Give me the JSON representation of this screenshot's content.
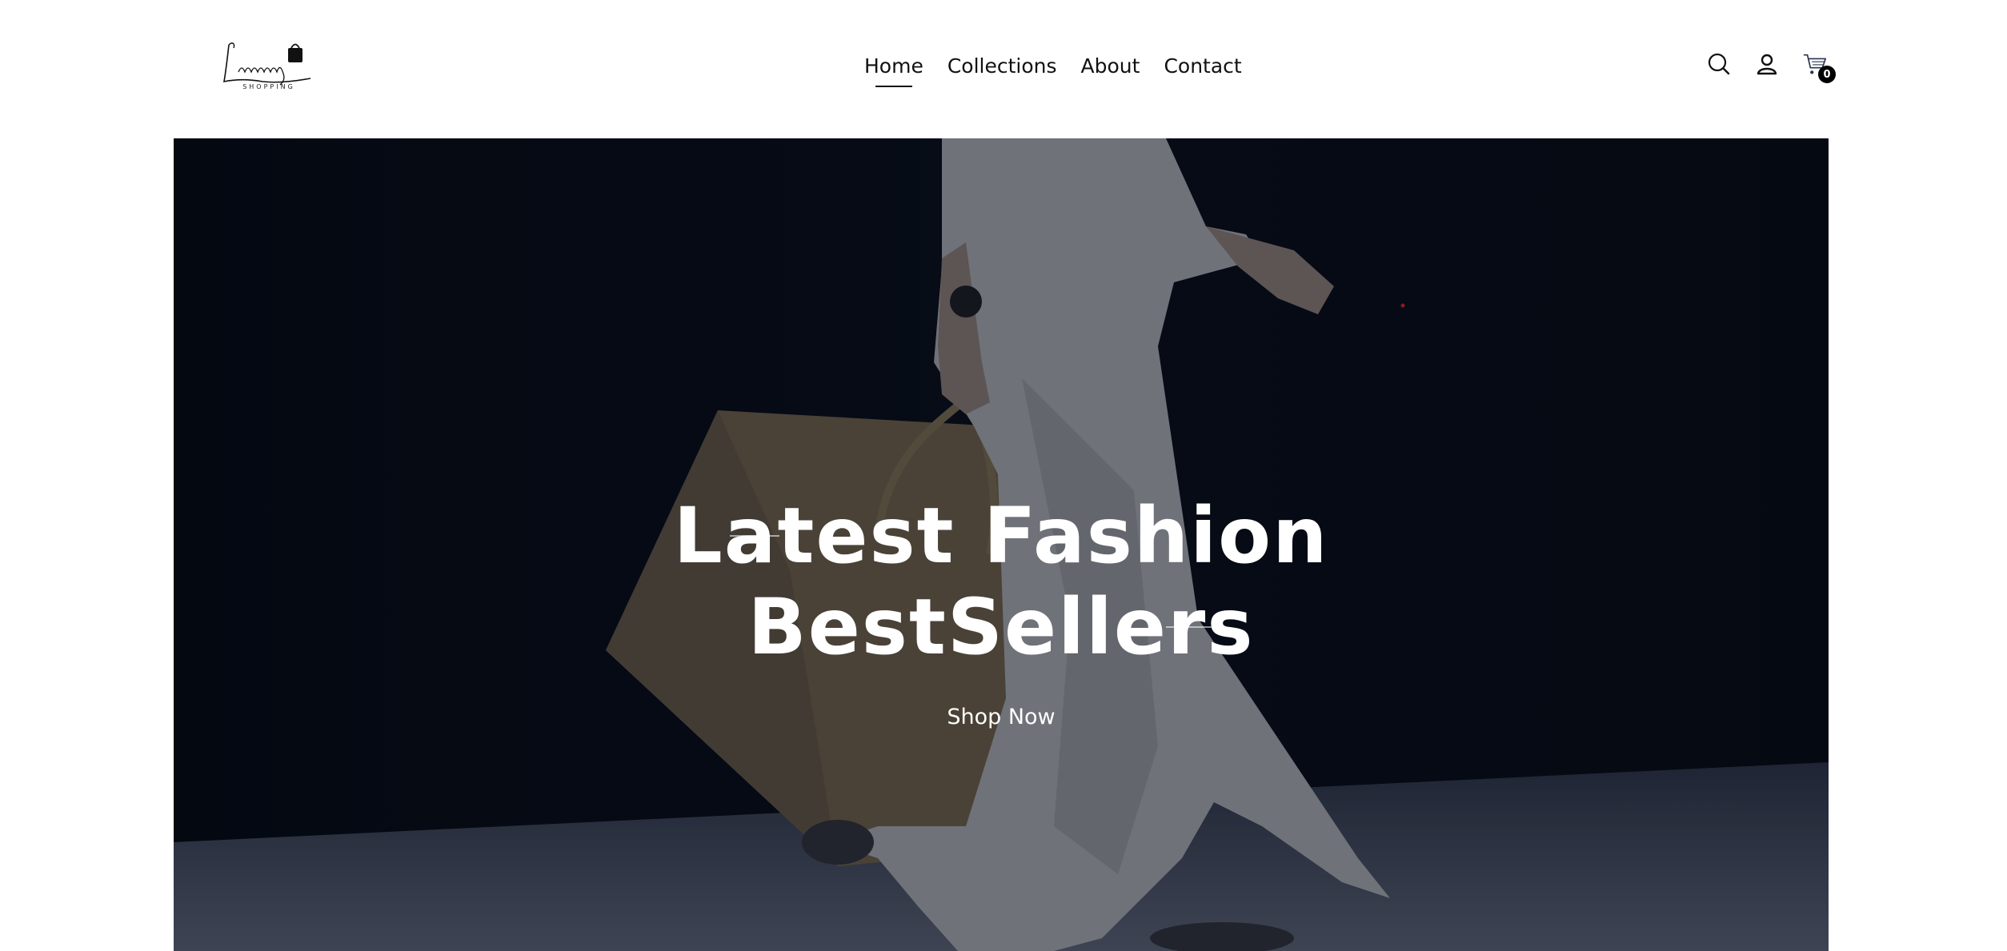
{
  "brand": {
    "logo_script": "Luxury",
    "logo_sub": "SHOPPING"
  },
  "nav": {
    "items": [
      {
        "label": "Home",
        "active": true
      },
      {
        "label": "Collections",
        "active": false
      },
      {
        "label": "About",
        "active": false
      },
      {
        "label": "Contact",
        "active": false
      }
    ]
  },
  "header_icons": {
    "search": "search-icon",
    "account": "user-icon",
    "cart": "cart-icon",
    "cart_count": "0"
  },
  "hero": {
    "title_line1": "Latest Fashion",
    "title_line2": "BestSellers",
    "cta_label": "Shop Now"
  },
  "colors": {
    "text": "#111111",
    "hero_overlay": "#05080f",
    "badge": "#000000"
  }
}
